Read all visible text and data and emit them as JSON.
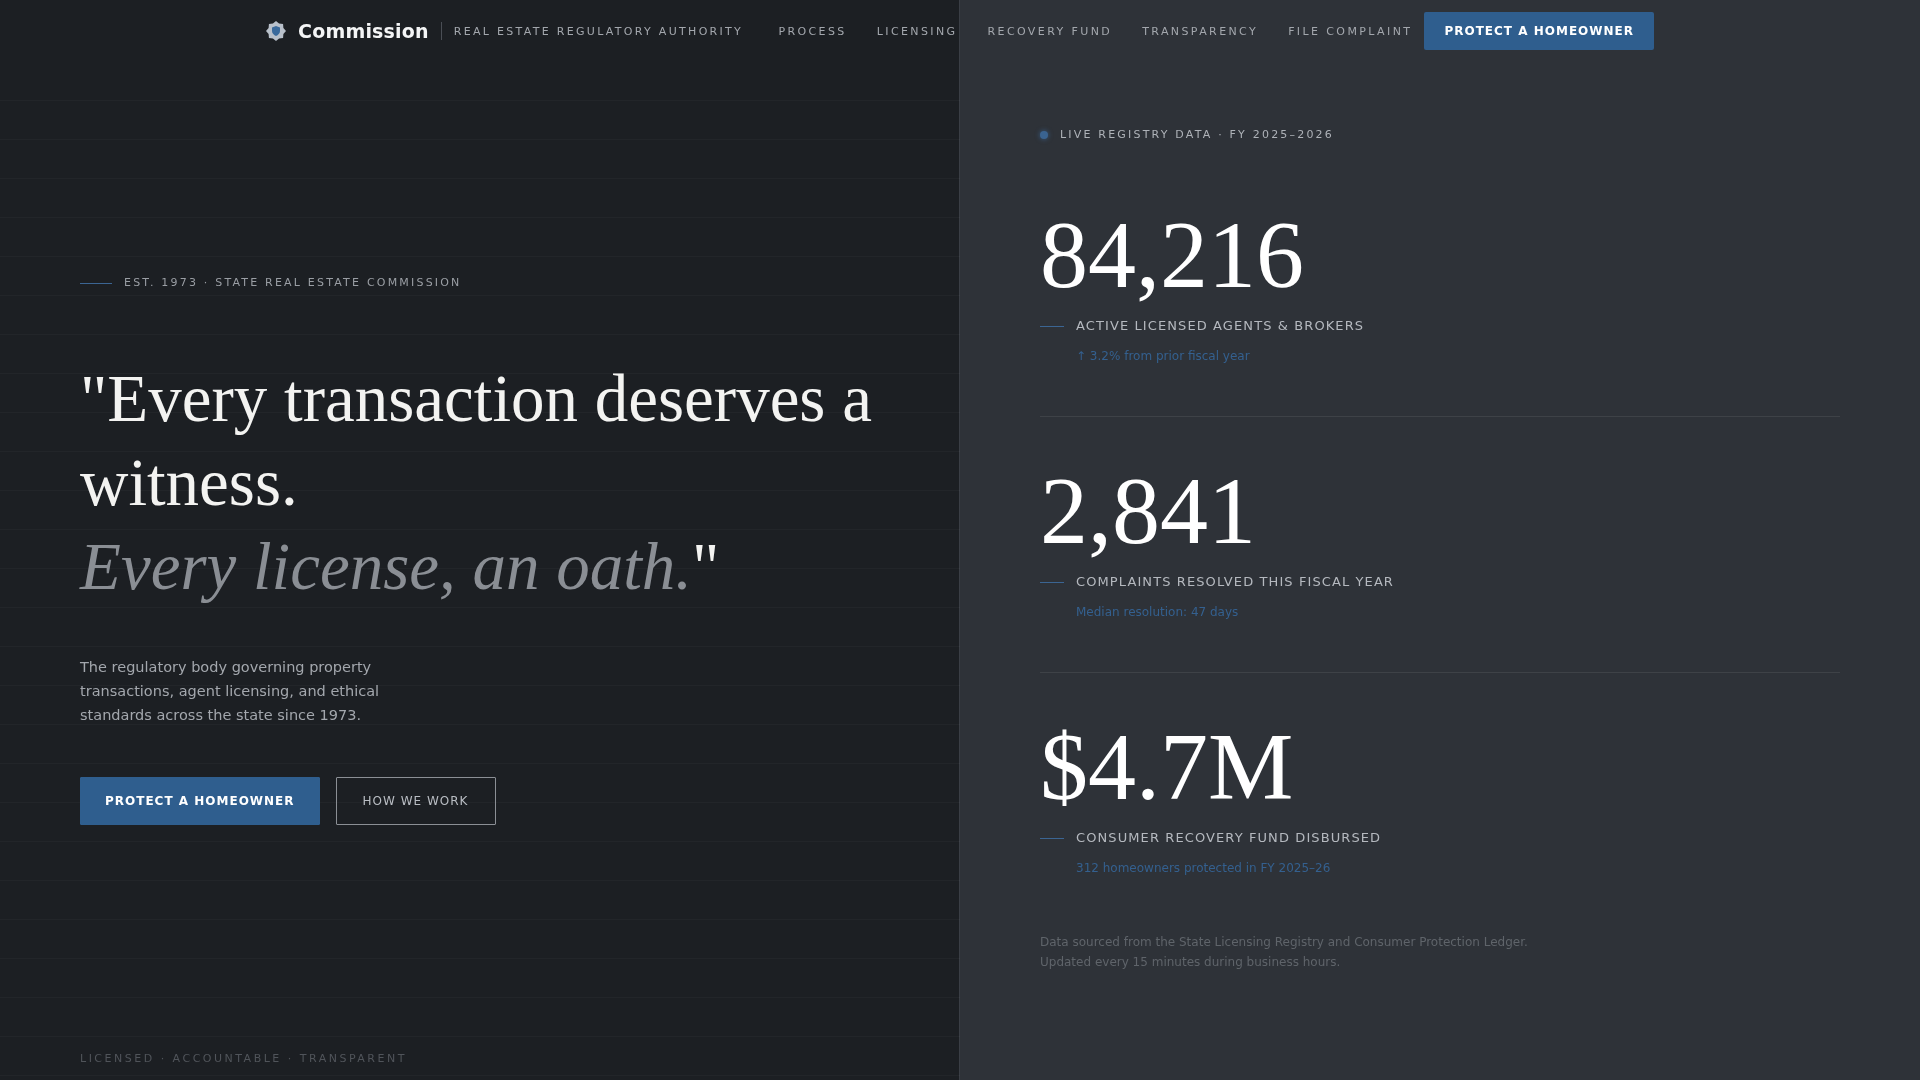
{
  "nav": {
    "brand": "Commission",
    "subtitle": "REAL ESTATE REGULATORY AUTHORITY",
    "links": [
      "PROCESS",
      "LICENSING",
      "RECOVERY FUND",
      "TRANSPARENCY",
      "FILE COMPLAINT"
    ],
    "cta": "PROTECT A HOMEOWNER"
  },
  "hero": {
    "eyebrow": "EST. 1973 · STATE REAL ESTATE COMMISSION",
    "headline": {
      "statement": "\"Every transaction deserves a witness.",
      "emphasis": "*Every license, an oath.*\""
    },
    "description": "The regulatory body governing property transactions, agent licensing, and ethical standards across the state since 1973.",
    "buttons": [
      {
        "label": "PROTECT A HOMEOWNER",
        "kind": "primary"
      },
      {
        "label": "HOW WE WORK",
        "kind": "secondary"
      }
    ],
    "tagline": "LICENSED · ACCOUNTABLE · TRANSPARENT"
  },
  "registry": {
    "eyebrow": "LIVE REGISTRY DATA · FY 2025–2026",
    "stats": [
      {
        "value": "84,216",
        "label": "ACTIVE LICENSED AGENTS & BROKERS",
        "note": "↑ 3.2% from prior fiscal year"
      },
      {
        "value": "2,841",
        "label": "COMPLAINTS RESOLVED THIS FISCAL YEAR",
        "note": "Median resolution: 47 days"
      },
      {
        "value": "$4.7M",
        "label": "CONSUMER RECOVERY FUND DISBURSED",
        "note": "312 homeowners protected in FY 2025–26"
      }
    ],
    "footnote": [
      "Data sourced from the State Licensing Registry and Consumer Protection Ledger.",
      "Updated every 15 minutes during business hours."
    ]
  }
}
